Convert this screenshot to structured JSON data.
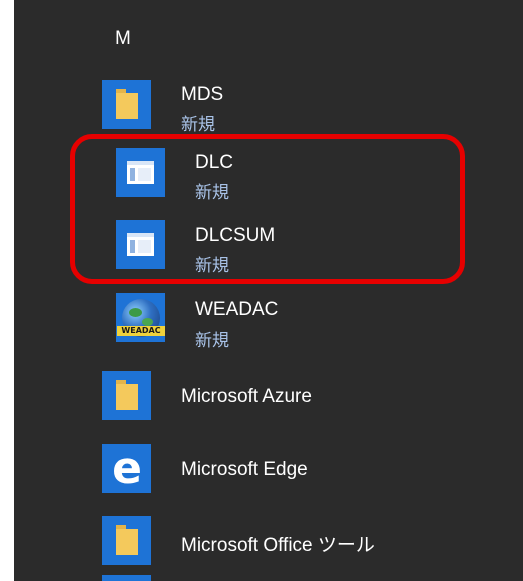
{
  "section_letter": "M",
  "items": [
    {
      "name": "MDS",
      "sub": "新規",
      "icon": "folder-icon"
    },
    {
      "name": "DLC",
      "sub": "新規",
      "icon": "app-window-icon"
    },
    {
      "name": "DLCSUM",
      "sub": "新規",
      "icon": "app-window-icon"
    },
    {
      "name": "WEADAC",
      "sub": "新規",
      "icon": "globe-icon"
    },
    {
      "name": "Microsoft Azure",
      "icon": "folder-icon"
    },
    {
      "name": "Microsoft Edge",
      "icon": "edge-icon"
    },
    {
      "name": "Microsoft Office ツール",
      "icon": "folder-icon"
    }
  ],
  "weadac_icon_text": "WEADAC",
  "edge_glyph": "e",
  "colors": {
    "background": "#2b2b2b",
    "tile_blue": "#1e73d6",
    "highlight": "#e60000",
    "folder_yellow": "#f4c95c",
    "sub_text": "#a9c3e8"
  }
}
